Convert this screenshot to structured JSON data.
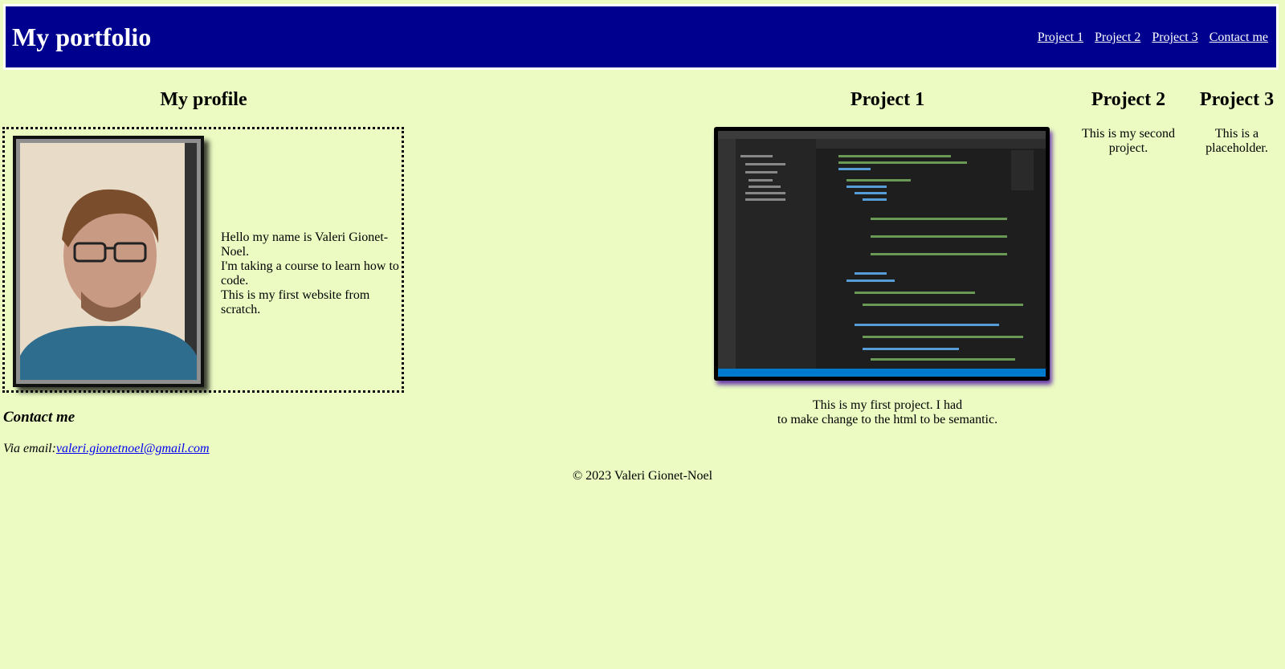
{
  "header": {
    "title": "My portfolio",
    "nav": [
      "Project 1",
      "Project 2",
      "Project 3",
      "Contact me"
    ]
  },
  "profile": {
    "heading": "My profile",
    "bio": [
      "Hello my name is Valeri Gionet-Noel.",
      "I'm taking a course to learn how to code.",
      "This is my first website from scratch."
    ]
  },
  "contact": {
    "heading": "Contact me",
    "prefix": "Via email:",
    "email": "valeri.gionetnoel@gmail.com"
  },
  "projects": [
    {
      "heading": "Project 1",
      "text": [
        "This is my first project. I had",
        "to make change to the html to be semantic."
      ]
    },
    {
      "heading": "Project 2",
      "text": [
        "This is my second",
        "project."
      ]
    },
    {
      "heading": "Project 3",
      "text": [
        "This is a",
        "placeholder."
      ]
    }
  ],
  "footer": "© 2023 Valeri Gionet-Noel",
  "colors": {
    "page_bg": "#ebfbc2",
    "header_bg": "#00008f",
    "link": "#0000ee"
  }
}
